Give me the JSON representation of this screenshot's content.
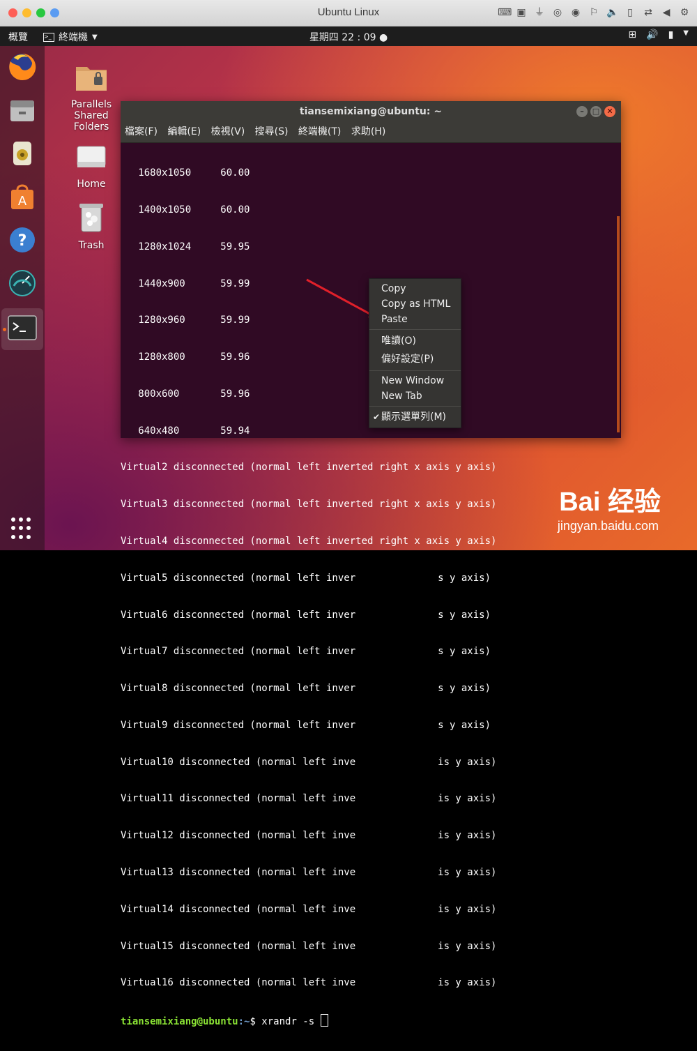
{
  "host_window": {
    "title": "Ubuntu Linux"
  },
  "host_toolbar_icons": [
    "keyboard-icon",
    "cpu-icon",
    "usb-icon",
    "cd-icon",
    "cd2-icon",
    "shared-folder-icon",
    "speaker-icon",
    "phone-icon",
    "network-icon",
    "triangle-left-icon",
    "gear-icon"
  ],
  "topbar": {
    "activities": "概覽",
    "app_menu": "終端機",
    "clock": "星期四 22 : 09",
    "tray_icons": [
      "network-icon",
      "volume-icon",
      "battery-icon",
      "power-dropdown-icon"
    ]
  },
  "dock": {
    "items": [
      "firefox-icon",
      "files-icon",
      "rhythmbox-icon",
      "software-icon",
      "help-icon",
      "stacer-icon",
      "terminal-icon"
    ]
  },
  "desktop_icons": [
    {
      "label_lines": [
        "Parallels",
        "Shared",
        "Folders"
      ]
    },
    {
      "label_lines": [
        "Home"
      ]
    },
    {
      "label_lines": [
        "Trash"
      ]
    }
  ],
  "terminal": {
    "title": "tiansemixiang@ubuntu: ~",
    "menu": [
      "檔案(F)",
      "編輯(E)",
      "檢視(V)",
      "搜尋(S)",
      "終端機(T)",
      "求助(H)"
    ],
    "lines": [
      "   1680x1050     60.00",
      "   1400x1050     60.00",
      "   1280x1024     59.95",
      "   1440x900      59.99",
      "   1280x960      59.99",
      "   1280x800      59.96",
      "   800x600       59.96",
      "   640x480       59.94",
      "Virtual2 disconnected (normal left inverted right x axis y axis)",
      "Virtual3 disconnected (normal left inverted right x axis y axis)",
      "Virtual4 disconnected (normal left inverted right x axis y axis)",
      "Virtual5 disconnected (normal left inver              s y axis)",
      "Virtual6 disconnected (normal left inver              s y axis)",
      "Virtual7 disconnected (normal left inver              s y axis)",
      "Virtual8 disconnected (normal left inver              s y axis)",
      "Virtual9 disconnected (normal left inver              s y axis)",
      "Virtual10 disconnected (normal left inve              is y axis)",
      "Virtual11 disconnected (normal left inve              is y axis)",
      "Virtual12 disconnected (normal left inve              is y axis)",
      "Virtual13 disconnected (normal left inve              is y axis)",
      "Virtual14 disconnected (normal left inve              is y axis)",
      "Virtual15 disconnected (normal left inve              is y axis)",
      "Virtual16 disconnected (normal left inve              is y axis)"
    ],
    "prompt_user": "tiansemixiang@ubuntu",
    "prompt_path": ":~",
    "prompt_cmd": "$ xrandr -s "
  },
  "context_menu": {
    "group1": [
      "Copy",
      "Copy as HTML",
      "Paste"
    ],
    "group2": [
      "唯讀(O)",
      "偏好設定(P)"
    ],
    "group3": [
      "New Window",
      "New Tab"
    ],
    "group4": [
      "顯示選單列(M)"
    ]
  },
  "watermark": {
    "brand": "Bai 经验",
    "url": "jingyan.baidu.com"
  },
  "colors": {
    "terminal_bg": "#300a24",
    "prompt_user": "#8ae234",
    "prompt_path": "#729fcf",
    "arrow": "#e0202a"
  }
}
